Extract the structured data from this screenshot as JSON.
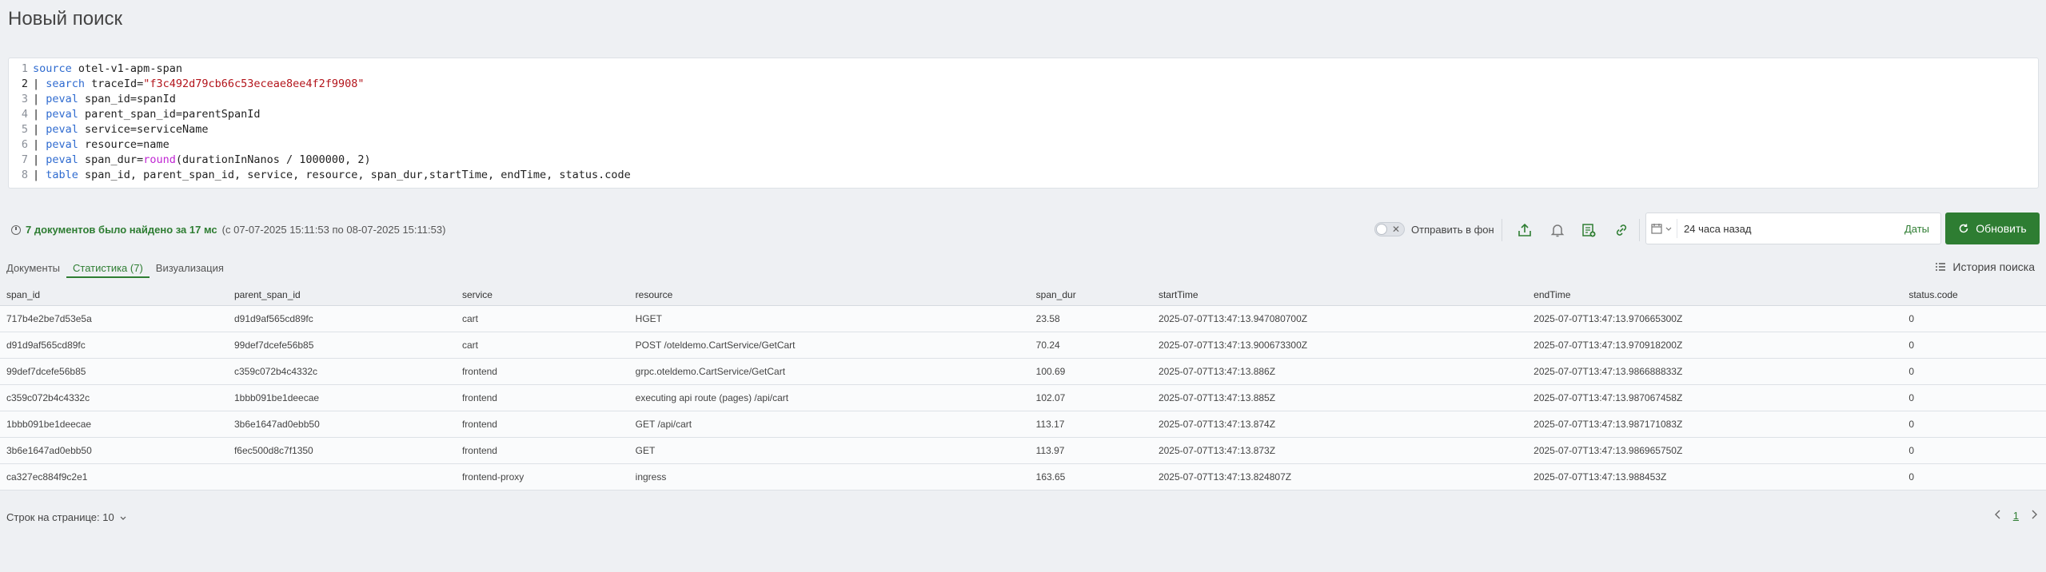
{
  "page": {
    "title": "Новый поиск"
  },
  "query_lines": [
    {
      "n": "1",
      "parts": [
        [
          "kw",
          "source"
        ],
        [
          "plain",
          " otel-v1-apm-span"
        ]
      ]
    },
    {
      "n": "2",
      "parts": [
        [
          "plain",
          "| "
        ],
        [
          "kw",
          "search"
        ],
        [
          "plain",
          " traceId="
        ],
        [
          "str",
          "\"f3c492d79cb66c53eceae8ee4f2f9908\""
        ]
      ]
    },
    {
      "n": "3",
      "parts": [
        [
          "plain",
          "| "
        ],
        [
          "kw",
          "peval"
        ],
        [
          "plain",
          " span_id=spanId"
        ]
      ]
    },
    {
      "n": "4",
      "parts": [
        [
          "plain",
          "| "
        ],
        [
          "kw",
          "peval"
        ],
        [
          "plain",
          " parent_span_id=parentSpanId"
        ]
      ]
    },
    {
      "n": "5",
      "parts": [
        [
          "plain",
          "| "
        ],
        [
          "kw",
          "peval"
        ],
        [
          "plain",
          " service=serviceName"
        ]
      ]
    },
    {
      "n": "6",
      "parts": [
        [
          "plain",
          "| "
        ],
        [
          "kw",
          "peval"
        ],
        [
          "plain",
          " resource=name"
        ]
      ]
    },
    {
      "n": "7",
      "parts": [
        [
          "plain",
          "| "
        ],
        [
          "kw",
          "peval"
        ],
        [
          "plain",
          " span_dur="
        ],
        [
          "fn",
          "round"
        ],
        [
          "plain",
          "(durationInNanos / 1000000, 2)"
        ]
      ]
    },
    {
      "n": "8",
      "parts": [
        [
          "plain",
          "| "
        ],
        [
          "kw",
          "table"
        ],
        [
          "plain",
          " span_id, parent_span_id, service, resource, span_dur,startTime, endTime, status.code"
        ]
      ]
    }
  ],
  "results": {
    "summary": "7 документов было найдено за 17 мс",
    "range": "(с 07-07-2025 15:11:53 по 08-07-2025 15:11:53)"
  },
  "toolbar": {
    "background_label": "Отправить в фон",
    "time_value": "24 часа назад",
    "dates_label": "Даты",
    "refresh_label": "Обновить"
  },
  "tabs": [
    {
      "label": "Документы",
      "active": false
    },
    {
      "label": "Статистика (7)",
      "active": true
    },
    {
      "label": "Визуализация",
      "active": false
    }
  ],
  "history_label": "История поиска",
  "table": {
    "columns": [
      "span_id",
      "parent_span_id",
      "service",
      "resource",
      "span_dur",
      "startTime",
      "endTime",
      "status.code"
    ],
    "rows": [
      [
        "717b4e2be7d53e5a",
        "d91d9af565cd89fc",
        "cart",
        "HGET",
        "23.58",
        "2025-07-07T13:47:13.947080700Z",
        "2025-07-07T13:47:13.970665300Z",
        "0"
      ],
      [
        "d91d9af565cd89fc",
        "99def7dcefe56b85",
        "cart",
        "POST /oteldemo.CartService/GetCart",
        "70.24",
        "2025-07-07T13:47:13.900673300Z",
        "2025-07-07T13:47:13.970918200Z",
        "0"
      ],
      [
        "99def7dcefe56b85",
        "c359c072b4c4332c",
        "frontend",
        "grpc.oteldemo.CartService/GetCart",
        "100.69",
        "2025-07-07T13:47:13.886Z",
        "2025-07-07T13:47:13.986688833Z",
        "0"
      ],
      [
        "c359c072b4c4332c",
        "1bbb091be1deecae",
        "frontend",
        "executing api route (pages) /api/cart",
        "102.07",
        "2025-07-07T13:47:13.885Z",
        "2025-07-07T13:47:13.987067458Z",
        "0"
      ],
      [
        "1bbb091be1deecae",
        "3b6e1647ad0ebb50",
        "frontend",
        "GET /api/cart",
        "113.17",
        "2025-07-07T13:47:13.874Z",
        "2025-07-07T13:47:13.987171083Z",
        "0"
      ],
      [
        "3b6e1647ad0ebb50",
        "f6ec500d8c7f1350",
        "frontend",
        "GET",
        "113.97",
        "2025-07-07T13:47:13.873Z",
        "2025-07-07T13:47:13.986965750Z",
        "0"
      ],
      [
        "ca327ec884f9c2e1",
        "",
        "frontend-proxy",
        "ingress",
        "163.65",
        "2025-07-07T13:47:13.824807Z",
        "2025-07-07T13:47:13.988453Z",
        "0"
      ]
    ]
  },
  "footer": {
    "rows_per_page": "Строк на странице: 10",
    "current_page": "1"
  },
  "colors": {
    "accent": "#2e7d32",
    "keyword": "#2f6bd0",
    "string": "#b3141b",
    "function": "#c026d3"
  }
}
